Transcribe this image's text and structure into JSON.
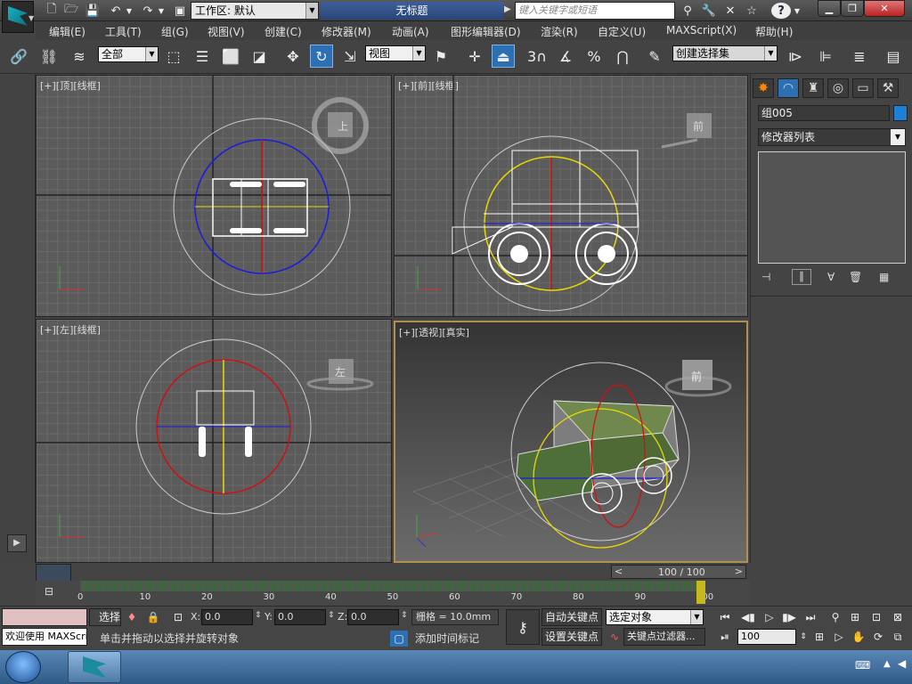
{
  "title_bar": {
    "workspace_label": "工作区: 默认",
    "document_title": "无标题",
    "search_placeholder": "键入关键字或短语",
    "help_label": "?"
  },
  "menu": [
    "编辑(E)",
    "工具(T)",
    "组(G)",
    "视图(V)",
    "创建(C)",
    "修改器(M)",
    "动画(A)",
    "图形编辑器(D)",
    "渲染(R)",
    "自定义(U)",
    "MAXScript(X)",
    "帮助(H)"
  ],
  "toolbar": {
    "selection_filter": "全部",
    "reference_coord": "视图",
    "snap_angle_label": "3",
    "named_selection_placeholder": "创建选择集"
  },
  "viewports": {
    "top": {
      "label": "[+][顶][线框]",
      "cube_face": "上"
    },
    "front": {
      "label": "[+][前][线框]",
      "cube_face": "前"
    },
    "left": {
      "label": "[+][左][线框]",
      "cube_face": "左"
    },
    "perspective": {
      "label": "[+][透视][真实]",
      "cube_face": "前"
    }
  },
  "command_panel": {
    "object_name": "组005",
    "object_color": "#1e7fd6",
    "modifier_list": "修改器列表"
  },
  "time_slider": {
    "frame": "100 / 100",
    "prev": "<",
    "next": ">"
  },
  "track_bar": {
    "ticks": [
      "0",
      "10",
      "20",
      "30",
      "40",
      "50",
      "60",
      "70",
      "80",
      "90",
      "100"
    ],
    "current": 100
  },
  "status": {
    "maxscript_listener": "欢迎使用 MAXScri",
    "select_label": "选择",
    "x_label": "X:",
    "x_value": "0.0",
    "y_label": "Y:",
    "y_value": "0.0",
    "z_label": "Z:",
    "z_value": "0.0",
    "grid_label": "栅格 = 10.0mm",
    "prompt": "单击并拖动以选择并旋转对象",
    "add_time_tag": "添加时间标记",
    "auto_key": "自动关键点",
    "set_key": "设置关键点",
    "key_mode_select": "选定对象",
    "key_filters": "关键点过滤器...",
    "current_frame": "100"
  },
  "colors": {
    "active_tool": "#2d6fb3",
    "selection_circle_blue": "#1a1ae0",
    "selection_circle_red": "#d01010",
    "gizmo_yellow": "#e8d800",
    "taskbar": "#3f6f9f"
  }
}
